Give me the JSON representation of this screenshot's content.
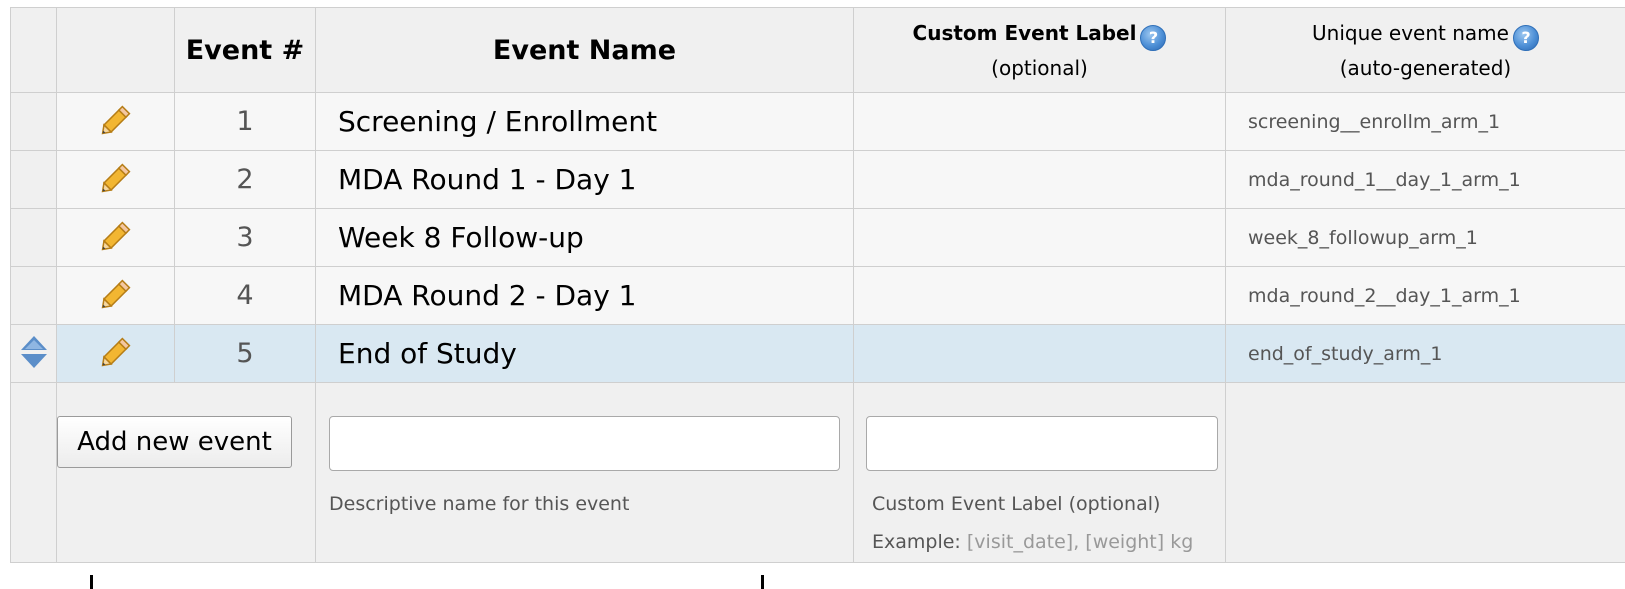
{
  "header": {
    "event_num": "Event #",
    "event_name": "Event Name",
    "custom_label_title": "Custom Event Label",
    "custom_label_sub": "(optional)",
    "unique_title": "Unique event name",
    "unique_sub": "(auto-generated)",
    "help_icon": "question-circle-icon"
  },
  "events": [
    {
      "num": "1",
      "name": "Screening / Enrollment",
      "custom_label": "",
      "unique": "screening__enrollm_arm_1"
    },
    {
      "num": "2",
      "name": "MDA Round 1 - Day 1",
      "custom_label": "",
      "unique": "mda_round_1__day_1_arm_1"
    },
    {
      "num": "3",
      "name": "Week 8 Follow-up",
      "custom_label": "",
      "unique": "week_8_followup_arm_1"
    },
    {
      "num": "4",
      "name": "MDA Round 2 - Day 1",
      "custom_label": "",
      "unique": "mda_round_2__day_1_arm_1"
    },
    {
      "num": "5",
      "name": "End of Study",
      "custom_label": "",
      "unique": "end_of_study_arm_1"
    }
  ],
  "add_form": {
    "add_button": "Add new event",
    "name_input_value": "",
    "name_hint": "Descriptive name for this event",
    "label_input_value": "",
    "label_hint": "Custom Event Label (optional)",
    "example_prefix": "Example:",
    "example_values": "[visit_date], [weight] kg"
  },
  "icons": {
    "edit": "pencil-icon",
    "reorder": "sort-arrows-icon"
  },
  "colors": {
    "active_row": "#d9e8f2",
    "header_bg": "#f0f0f0",
    "row_bg": "#f7f7f7",
    "help_icon": "#4d8fd6"
  }
}
